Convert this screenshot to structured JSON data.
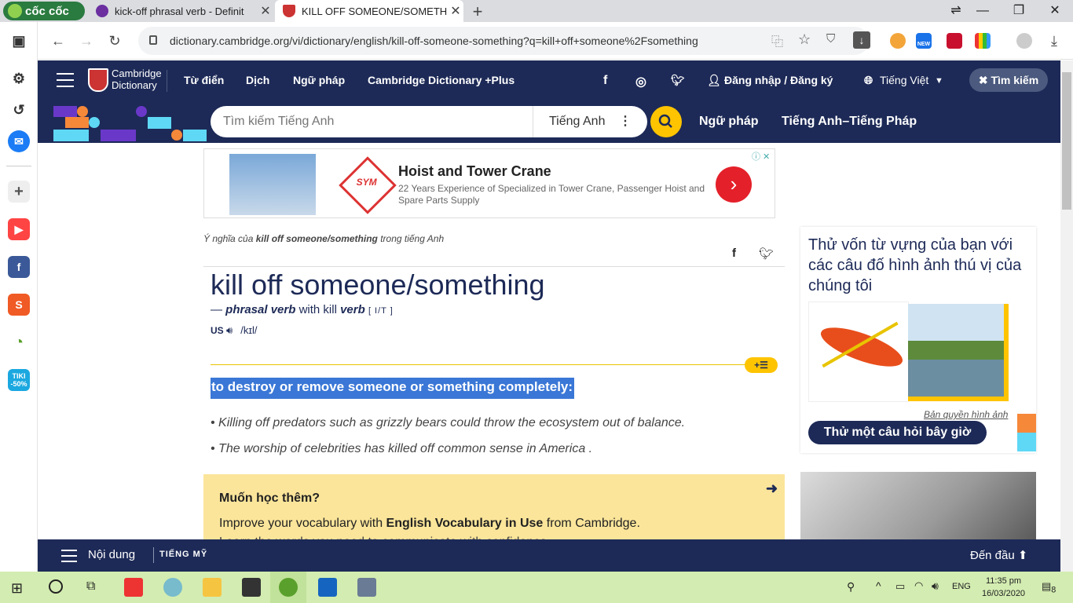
{
  "browser": {
    "brand": "cốc cốc",
    "tabs": [
      {
        "title": "kick-off phrasal verb - Definit",
        "active": false
      },
      {
        "title": "KILL OFF SOMEONE/SOMETH",
        "active": true
      }
    ],
    "url": "dictionary.cambridge.org/vi/dictionary/english/kill-off-someone-something?q=kill+off+someone%2Fsomething",
    "new_badge": "NEW"
  },
  "rail": {
    "tiki_label": "TIKI -50%"
  },
  "header": {
    "logo_line1": "Cambridge",
    "logo_line2": "Dictionary",
    "nav": [
      "Từ điển",
      "Dịch",
      "Ngữ pháp",
      "Cambridge Dictionary +Plus"
    ],
    "login": "Đăng nhập / Đăng ký",
    "language": "Tiếng Việt",
    "search_toggle": "Tìm kiếm"
  },
  "subheader": {
    "search_placeholder": "Tìm kiếm Tiếng Anh",
    "search_lang": "Tiếng Anh",
    "links": [
      "Ngữ pháp",
      "Tiếng Anh–Tiếng Pháp"
    ]
  },
  "ad": {
    "title": "Hoist and Tower Crane",
    "description": "22 Years Experience of Specialized in Tower Crane, Passenger Hoist and Spare Parts Supply",
    "logo_text": "SYM"
  },
  "entry": {
    "crumb_prefix": "Ý nghĩa của ",
    "crumb_term": "kill off someone/something",
    "crumb_suffix": " trong tiếng Anh",
    "headword": "kill off someone/something",
    "pos_dash": "—",
    "pos": "phrasal verb",
    "pos_with": "with kill",
    "pos_verb": "verb",
    "grammar": "[ I/T ]",
    "region": "US",
    "ipa": "/kɪl/",
    "definition": "to destroy or remove someone or something completely:",
    "examples": [
      "Killing off predators such as grizzly bears could throw the ecosystem out of balance.",
      "The worship of celebrities has killed off common sense in America ."
    ],
    "addlist": "+☰"
  },
  "learn_more": {
    "title": "Muốn học thêm?",
    "text_before": "Improve your vocabulary with ",
    "text_bold": "English Vocabulary in Use",
    "text_after": " from Cambridge.",
    "text2": "Learn the words you need to communicate with confidence."
  },
  "quiz": {
    "title": "Thử vốn từ vựng của bạn với các câu đố hình ảnh thú vị của chúng tôi",
    "credit": "Bản quyền hình ảnh",
    "button": "Thử một câu hỏi bây giờ"
  },
  "bottombar": {
    "contents": "Nội dung",
    "region": "TIẾNG MỸ",
    "to_top": "Đến đầu"
  },
  "taskbar": {
    "lang": "ENG",
    "time": "11:35 pm",
    "date": "16/03/2020",
    "notifications": "8"
  }
}
